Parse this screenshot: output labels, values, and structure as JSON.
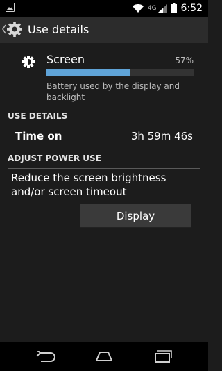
{
  "status_bar": {
    "network_type": "4G",
    "time": "6:52"
  },
  "action_bar": {
    "title": "Use details"
  },
  "app": {
    "name": "Screen",
    "percent_label": "57%",
    "percent": 57,
    "description": "Battery used by the display and backlight"
  },
  "use_details": {
    "header": "USE DETAILS",
    "time_on_label": "Time on",
    "time_on_value": "3h 59m 46s"
  },
  "power": {
    "header": "ADJUST POWER USE",
    "message": "Reduce the screen brightness and/or screen timeout",
    "button_label": "Display"
  },
  "colors": {
    "accent": "#5fa3d7",
    "background": "#1c1c1c",
    "action_bar": "#2c2c2c",
    "button": "#3a3a3a"
  },
  "icons": [
    "image-notification-icon",
    "wifi-icon",
    "signal-icon",
    "battery-icon",
    "up-caret-icon",
    "settings-gear-icon",
    "brightness-icon",
    "back-icon",
    "home-icon",
    "recent-apps-icon"
  ]
}
